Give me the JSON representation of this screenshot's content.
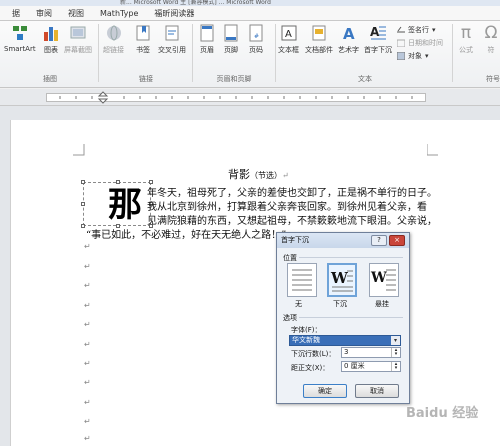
{
  "window": {
    "title": "新... Microsoft Word 主 [兼容模式] ... Microsoft Word"
  },
  "tabs": [
    "据",
    "审阅",
    "视图",
    "MathType",
    "福昕阅读器"
  ],
  "ribbon": {
    "insert_group": {
      "label": "插图",
      "buttons": [
        "SmartArt",
        "图表",
        "屏幕截图"
      ]
    },
    "link_group": {
      "label": "链接",
      "buttons": [
        "超链接",
        "书签",
        "交叉引用"
      ]
    },
    "header_group": {
      "label": "页眉和页脚",
      "buttons": [
        "页眉",
        "页脚",
        "页码"
      ]
    },
    "text_group": {
      "label": "文本",
      "buttons": [
        "文本框",
        "文档部件",
        "艺术字",
        "首字下沉"
      ],
      "small": [
        "签名行",
        "日期和时间",
        "对象"
      ]
    },
    "symbol_group": {
      "label": "符号",
      "buttons": [
        "公式",
        "符"
      ]
    }
  },
  "document": {
    "title": "背影",
    "title_note": "（节选）",
    "dropcap_char": "那",
    "lines": [
      "年冬天，祖母死了，父亲的差使也交卸了，正是祸不单行的日子。",
      "我从北京到徐州，打算跟着父亲奔丧回家。到徐州见着父亲，看",
      "见满院狼藉的东西，又想起祖母，不禁簌簌地流下眼泪。父亲说，",
      "“事已如此，不必难过，好在天无绝人之路！”"
    ],
    "para_mark": "↵"
  },
  "dialog": {
    "title": "首字下沉",
    "help": "?",
    "close": "×",
    "position_label": "位置",
    "options": [
      "无",
      "下沉",
      "悬挂"
    ],
    "options_section": "选项",
    "font_label": "字体(F)：",
    "font_value": "华文新魏",
    "lines_label": "下沉行数(L)：",
    "lines_value": "3",
    "distance_label": "距正文(X)：",
    "distance_value": "0 厘米",
    "ok": "确定",
    "cancel": "取消"
  },
  "watermark": "Baidu 经验"
}
